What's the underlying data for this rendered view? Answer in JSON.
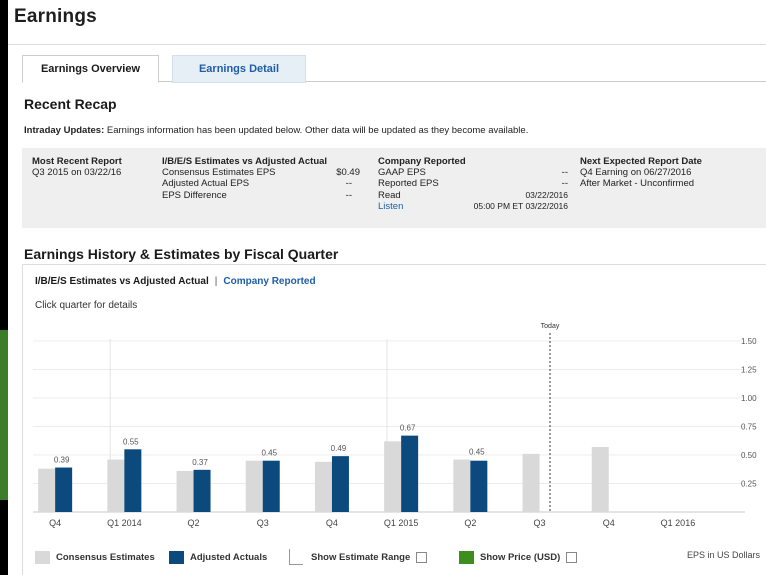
{
  "page_title": "Earnings",
  "tabs": [
    {
      "label": "Earnings Overview",
      "active": true
    },
    {
      "label": "Earnings Detail",
      "active": false
    }
  ],
  "recap": {
    "title": "Recent Recap",
    "intraday_label": "Intraday Updates:",
    "intraday_text": " Earnings information has been updated below. Other data will be updated as they become available.",
    "most_recent": {
      "heading": "Most Recent Report",
      "value": "Q3 2015 on 03/22/16"
    },
    "ibes": {
      "heading": "I/B/E/S Estimates vs Adjusted Actual",
      "rows": [
        {
          "label": "Consensus Estimates EPS",
          "value": "$0.49"
        },
        {
          "label": "Adjusted Actual EPS",
          "value": "--"
        },
        {
          "label": "EPS Difference",
          "value": "--"
        }
      ]
    },
    "company": {
      "heading": "Company Reported",
      "rows": [
        {
          "label": "GAAP EPS",
          "value": "--"
        },
        {
          "label": "Reported EPS",
          "value": "--"
        },
        {
          "label": "Read",
          "value": "03/22/2016"
        },
        {
          "label": "Listen",
          "value": "05:00 PM ET 03/22/2016"
        }
      ]
    },
    "next": {
      "heading": "Next Expected Report Date",
      "line1": "Q4 Earning on 06/27/2016",
      "line2": "After Market - Unconfirmed"
    }
  },
  "history": {
    "title": "Earnings History & Estimates by Fiscal Quarter",
    "view_active": "I/B/E/S Estimates vs Adjusted Actual",
    "view_separator": "|",
    "view_link": "Company Reported",
    "hint": "Click quarter for details"
  },
  "chart_data": {
    "type": "bar",
    "categories": [
      "Q4",
      "Q1 2014",
      "Q2",
      "Q3",
      "Q4",
      "Q1 2015",
      "Q2",
      "Q3",
      "Q4",
      "Q1 2016"
    ],
    "series": [
      {
        "name": "Consensus Estimates",
        "color": "#d9d9d9",
        "values": [
          0.38,
          0.46,
          0.36,
          0.45,
          0.44,
          0.62,
          0.46,
          0.51,
          0.57,
          null
        ]
      },
      {
        "name": "Adjusted Actuals",
        "color": "#0c4a7d",
        "values": [
          0.39,
          0.55,
          0.37,
          0.45,
          0.49,
          0.67,
          0.45,
          null,
          null,
          null
        ]
      }
    ],
    "data_labels": [
      "0.39",
      "0.55",
      "0.37",
      "0.45",
      "0.49",
      "0.67",
      "0.45",
      null,
      null,
      null
    ],
    "ylim": [
      0,
      1.5
    ],
    "y_ticks": [
      "0.25",
      "0.50",
      "0.75",
      "1.00",
      "1.25",
      "1.50"
    ],
    "y_tick_values": [
      0.25,
      0.5,
      0.75,
      1.0,
      1.25,
      1.5
    ],
    "today_label": "Today",
    "today_after_index": 7,
    "year_dividers_at_index": [
      1,
      5
    ],
    "grid": true,
    "y_axis_position": "right"
  },
  "legend": {
    "consensus": "Consensus Estimates",
    "actuals": "Adjusted Actuals",
    "range": "Show Estimate Range",
    "price": "Show Price (USD)",
    "price_color": "#3e8e1f",
    "units": "EPS in US Dollars"
  }
}
